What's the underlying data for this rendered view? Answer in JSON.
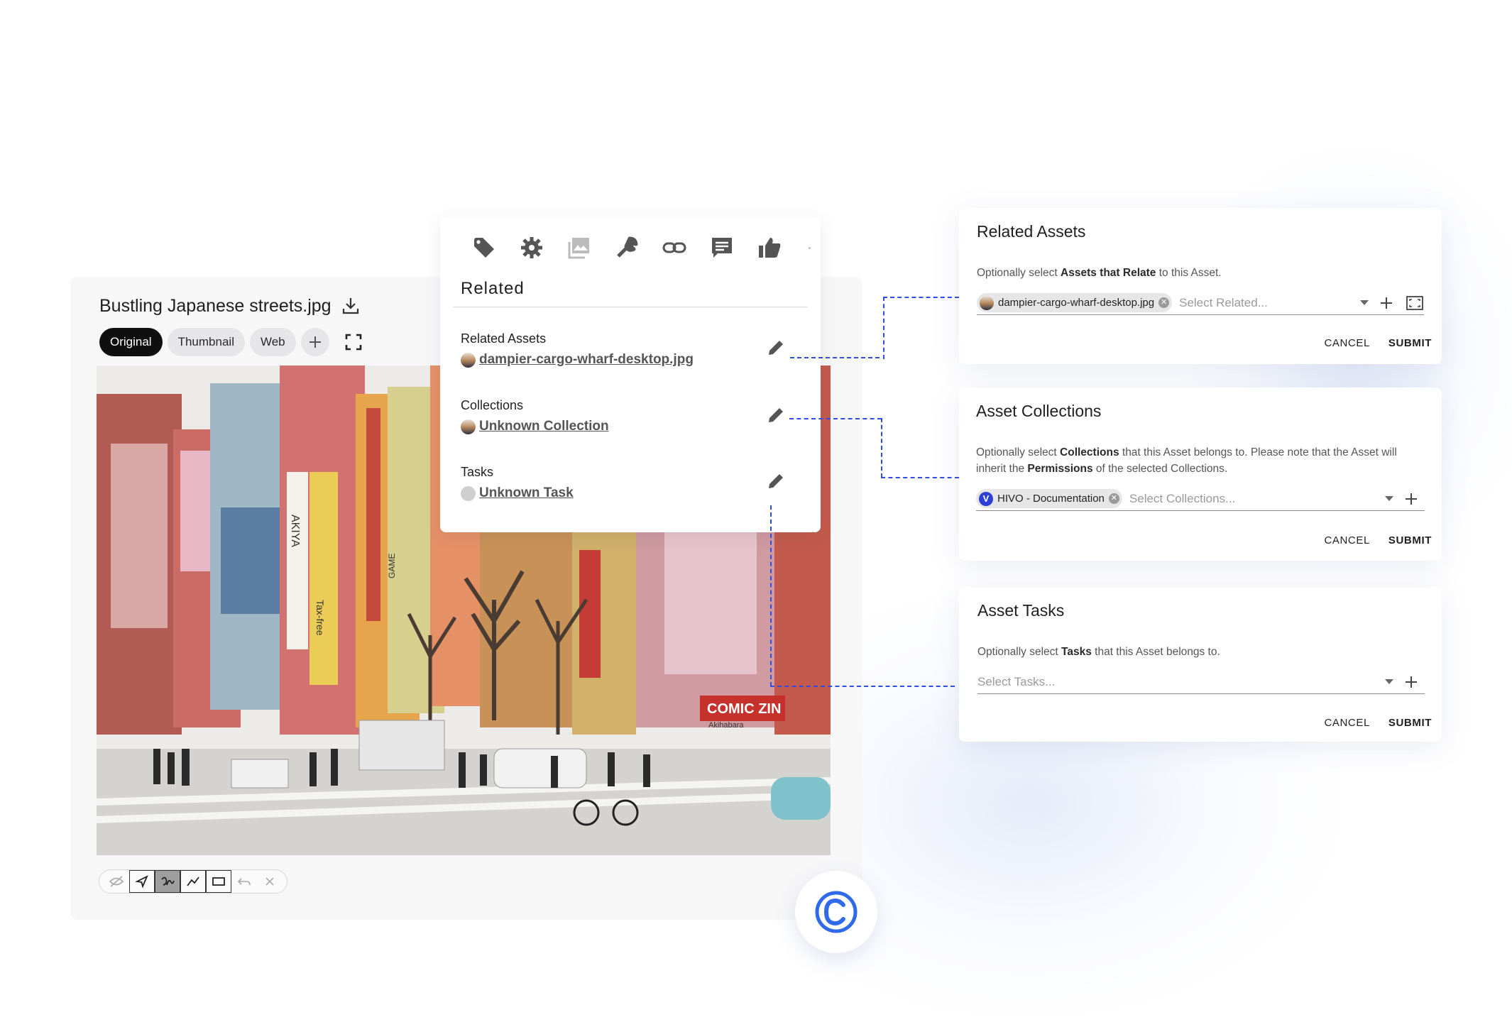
{
  "viewer": {
    "title": "Bustling Japanese streets.jpg",
    "renditions": [
      "Original",
      "Thumbnail",
      "Web"
    ],
    "active_rendition": "Original"
  },
  "photo": {
    "signs": [
      "AKIYA",
      "Tax-free",
      "COMIC ZIN",
      "Akihabara",
      "GAME"
    ]
  },
  "related_panel": {
    "heading": "Related",
    "tab_icons": [
      "tag-icon",
      "gear-icon",
      "images-icon",
      "wrench-icon",
      "link-icon",
      "comment-icon",
      "thumbs-up-icon"
    ],
    "sections": [
      {
        "label": "Related Assets",
        "value": "dampier-cargo-wharf-desktop.jpg"
      },
      {
        "label": "Collections",
        "value": "Unknown Collection"
      },
      {
        "label": "Tasks",
        "value": "Unknown Task"
      }
    ]
  },
  "forms": {
    "related": {
      "title": "Related Assets",
      "help_pre": "Optionally select ",
      "help_bold": "Assets that Relate",
      "help_post": " to this Asset.",
      "chip": "dampier-cargo-wharf-desktop.jpg",
      "placeholder": "Select Related...",
      "cancel": "CANCEL",
      "submit": "SUBMIT"
    },
    "collections": {
      "title": "Asset Collections",
      "help_pre": "Optionally select ",
      "help_bold": "Collections",
      "help_mid": " that this Asset belongs to. Please note that the Asset will inherit the ",
      "help_bold2": "Permissions",
      "help_post": " of the selected Collections.",
      "chip": "HIVO - Documentation",
      "chip_logo": "V",
      "placeholder": "Select Collections...",
      "cancel": "CANCEL",
      "submit": "SUBMIT"
    },
    "tasks": {
      "title": "Asset Tasks",
      "help_pre": "Optionally select ",
      "help_bold": "Tasks",
      "help_post": " that this Asset belongs to.",
      "placeholder": "Select Tasks...",
      "cancel": "CANCEL",
      "submit": "SUBMIT"
    }
  },
  "colors": {
    "accent_blue": "#2f4de4",
    "active_pill": "#0f0f10"
  }
}
